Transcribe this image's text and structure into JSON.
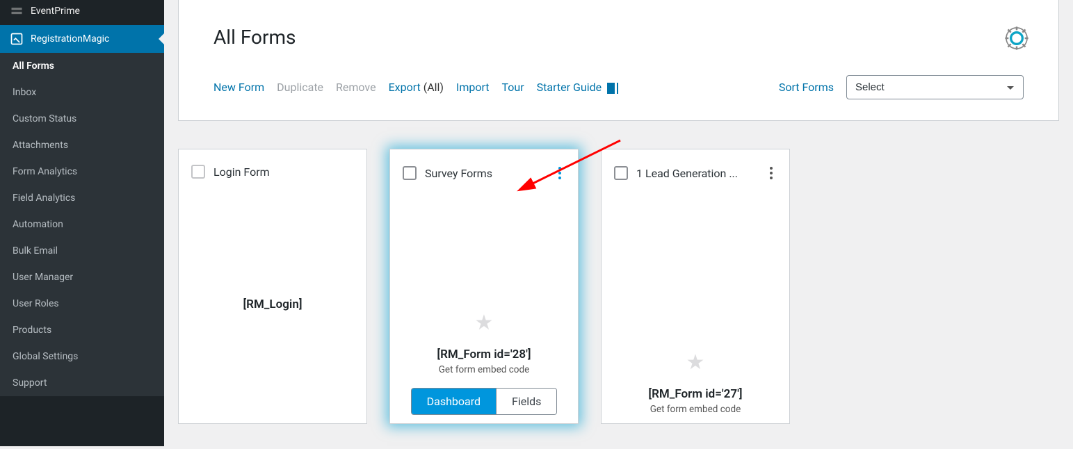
{
  "sidebar": {
    "plugins": [
      {
        "label": "EventPrime",
        "active": false
      },
      {
        "label": "RegistrationMagic",
        "active": true
      }
    ],
    "subs": [
      {
        "label": "All Forms",
        "current": true
      },
      {
        "label": "Inbox"
      },
      {
        "label": "Custom Status"
      },
      {
        "label": "Attachments"
      },
      {
        "label": "Form Analytics"
      },
      {
        "label": "Field Analytics"
      },
      {
        "label": "Automation"
      },
      {
        "label": "Bulk Email"
      },
      {
        "label": "User Manager"
      },
      {
        "label": "User Roles"
      },
      {
        "label": "Products"
      },
      {
        "label": "Global Settings"
      },
      {
        "label": "Support"
      }
    ]
  },
  "header": {
    "title": "All Forms"
  },
  "toolbar": {
    "new_form": "New Form",
    "duplicate": "Duplicate",
    "remove": "Remove",
    "export": "Export",
    "export_suffix": "(All)",
    "import": "Import",
    "tour": "Tour",
    "starter_guide": "Starter Guide",
    "sort_label": "Sort Forms",
    "sort_selected": "Select"
  },
  "cards": [
    {
      "title": "Login Form",
      "shortcode": "[RM_Login]",
      "simple": true
    },
    {
      "title": "Survey Forms",
      "shortcode": "[RM_Form id='28']",
      "embed_hint": "Get form embed code",
      "highlighted": true,
      "buttons": {
        "dashboard": "Dashboard",
        "fields": "Fields"
      },
      "kebab": "blue"
    },
    {
      "title": "1 Lead Generation ...",
      "shortcode": "[RM_Form id='27']",
      "embed_hint": "Get form embed code",
      "kebab": "gray"
    }
  ]
}
